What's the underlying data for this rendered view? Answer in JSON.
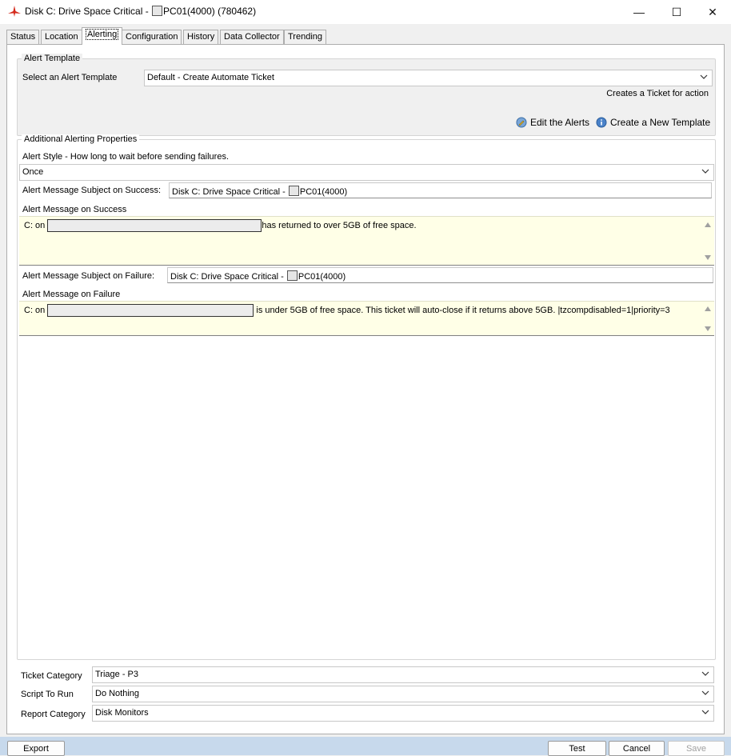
{
  "window": {
    "title_prefix": "Disk C: Drive Space Critical - ",
    "title_suffix": "PC01(4000) (780462)",
    "minimize_glyph": "—",
    "maximize_glyph": "☐",
    "close_glyph": "✕"
  },
  "tabs": [
    "Status",
    "Location",
    "Alerting",
    "Configuration",
    "History",
    "Data Collector",
    "Trending"
  ],
  "active_tab": "Alerting",
  "alert_template": {
    "legend": "Alert Template",
    "select_label": "Select an Alert Template",
    "selected": "Default - Create Automate Ticket",
    "description": "Creates a Ticket for action",
    "edit_link": "Edit the Alerts",
    "create_link": "Create a New Template"
  },
  "additional": {
    "legend": "Additional Alerting Properties",
    "style_label": "Alert Style - How long to wait before sending failures.",
    "style_value": "Once",
    "success_subject_label": "Alert Message Subject on Success:",
    "success_subject_prefix": "Disk C: Drive Space Critical - ",
    "success_subject_suffix": "PC01(4000)",
    "success_message_label": "Alert Message on Success",
    "success_message_prefix": "C: on ",
    "success_message_suffix": "has returned to over 5GB of free space.",
    "failure_subject_label": "Alert Message Subject on Failure:",
    "failure_subject_prefix": "Disk C: Drive Space Critical - ",
    "failure_subject_suffix": "PC01(4000)",
    "failure_message_label": "Alert Message on Failure",
    "failure_message_prefix": "C: on ",
    "failure_message_suffix": " is under 5GB of free space. This ticket will auto-close if it returns above 5GB. |tzcompdisabled=1|priority=3"
  },
  "bottom_fields": {
    "ticket_category_label": "Ticket Category",
    "ticket_category_value": "Triage - P3",
    "script_label": "Script To Run",
    "script_value": "Do Nothing",
    "report_label": "Report Category",
    "report_value": "Disk Monitors"
  },
  "buttons": {
    "export": "Export",
    "test": "Test",
    "cancel": "Cancel",
    "save": "Save"
  },
  "colors": {
    "memo_background": "#ffffe7",
    "bottom_bar": "#c7d9ec",
    "app_icon": "#d42a1c"
  }
}
